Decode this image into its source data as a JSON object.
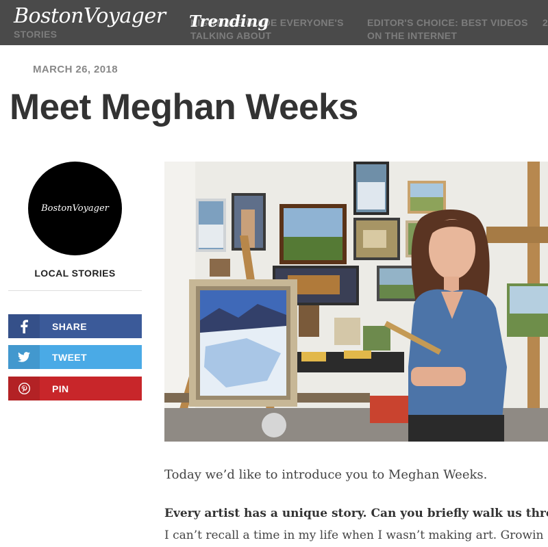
{
  "header": {
    "logo": "BostonVoyager",
    "trending_label": "Trending",
    "ticker_items": [
      "Stories",
      "Nightlife Guide Everyone's Talking About",
      "Editor's Choice: Best Videos On The Internet",
      "2"
    ]
  },
  "article": {
    "date": "MARCH 26, 2018",
    "title": "Meet Meghan Weeks",
    "intro": "Today we’d like to introduce you to Meghan Weeks.",
    "question": "Every artist has a unique story. Can you briefly walk us thro",
    "answer_start": "I can’t recall a time in my life when I wasn’t making art. Growin"
  },
  "sidebar": {
    "avatar_text": "BostonVoyager",
    "category": "LOCAL STORIES",
    "share_buttons": [
      {
        "label": "SHARE",
        "icon": "facebook-icon",
        "color": "#3b5a99"
      },
      {
        "label": "TWEET",
        "icon": "twitter-icon",
        "color": "#4aaae6"
      },
      {
        "label": "PIN",
        "icon": "pinterest-icon",
        "color": "#c8262a"
      }
    ]
  }
}
